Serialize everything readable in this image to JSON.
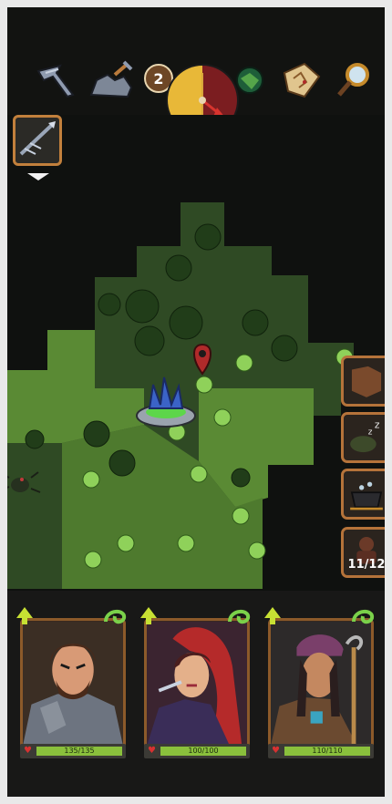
{
  "toolbar": {
    "items": [
      {
        "name": "pickaxe-icon"
      },
      {
        "name": "rock-icon"
      },
      {
        "name": "goblin-icon"
      },
      {
        "name": "treasure-map-icon"
      },
      {
        "name": "magnifier-icon"
      }
    ],
    "day_number": "2"
  },
  "side_panel": {
    "camp_count": "11/12"
  },
  "party": [
    {
      "hp": "135/135",
      "hp_fraction": 1.0
    },
    {
      "hp": "100/100",
      "hp_fraction": 1.0
    },
    {
      "hp": "110/110",
      "hp_fraction": 1.0
    }
  ],
  "colors": {
    "accent": "#c2803c",
    "hp": "#8ac03c",
    "level_up": "#c7e033",
    "marker": "#b02a2a"
  }
}
